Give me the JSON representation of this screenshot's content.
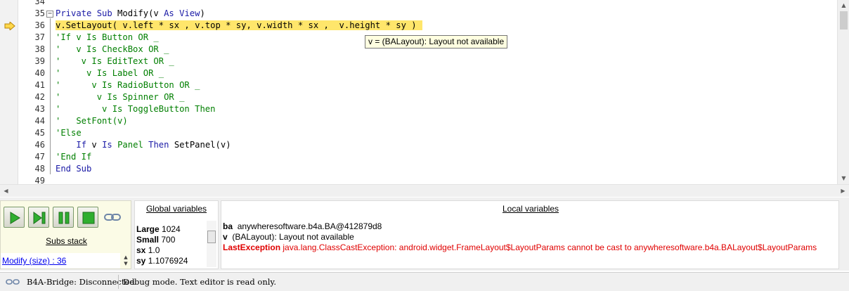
{
  "editor": {
    "lines": [
      {
        "num": "34",
        "segs": []
      },
      {
        "num": "35",
        "segs": [
          [
            "kw",
            "Private Sub"
          ],
          [
            "t",
            " Modify(v "
          ],
          [
            "kw",
            "As"
          ],
          [
            "t",
            " "
          ],
          [
            "kw",
            "View"
          ],
          [
            "t",
            ")"
          ]
        ]
      },
      {
        "num": "36",
        "segs": [
          [
            "t",
            "v.SetLayout( v.left * sx , v.top * sy, v.width * sx ,  v.height * sy )"
          ]
        ]
      },
      {
        "num": "37",
        "segs": [
          [
            "cm",
            "'If v Is Button OR _"
          ]
        ]
      },
      {
        "num": "38",
        "segs": [
          [
            "cm",
            "'   v Is CheckBox OR _"
          ]
        ]
      },
      {
        "num": "39",
        "segs": [
          [
            "cm",
            "'    v Is EditText OR _"
          ]
        ]
      },
      {
        "num": "40",
        "segs": [
          [
            "cm",
            "'     v Is Label OR _"
          ]
        ]
      },
      {
        "num": "41",
        "segs": [
          [
            "cm",
            "'      v Is RadioButton OR _"
          ]
        ]
      },
      {
        "num": "42",
        "segs": [
          [
            "cm",
            "'       v Is Spinner OR _"
          ]
        ]
      },
      {
        "num": "43",
        "segs": [
          [
            "cm",
            "'        v Is ToggleButton Then"
          ]
        ]
      },
      {
        "num": "44",
        "segs": [
          [
            "cm",
            "'   SetFont(v)"
          ]
        ]
      },
      {
        "num": "45",
        "segs": [
          [
            "cm",
            "'Else"
          ]
        ]
      },
      {
        "num": "46",
        "segs": [
          [
            "t",
            "    "
          ],
          [
            "kw",
            "If"
          ],
          [
            "t",
            " v "
          ],
          [
            "kw",
            "Is"
          ],
          [
            "t",
            " "
          ],
          [
            "cm",
            "Panel"
          ],
          [
            "t",
            " "
          ],
          [
            "kw",
            "Then"
          ],
          [
            "t",
            " SetPanel(v)"
          ]
        ]
      },
      {
        "num": "47",
        "segs": [
          [
            "cm",
            "'End If"
          ]
        ]
      },
      {
        "num": "48",
        "segs": [
          [
            "kw",
            "End Sub"
          ]
        ]
      },
      {
        "num": "49",
        "segs": []
      }
    ],
    "highlighted_line": "36",
    "tooltip": "v = (BALayout): Layout not available"
  },
  "subs_stack": {
    "title": "Subs stack",
    "items": [
      "Modify (size) : 36"
    ]
  },
  "global_variables": {
    "title": "Global variables",
    "items": [
      {
        "name": "Large",
        "value": "1024"
      },
      {
        "name": "Small",
        "value": "700"
      },
      {
        "name": "sx",
        "value": "1.0"
      },
      {
        "name": "sy",
        "value": "1.1076924"
      }
    ]
  },
  "local_variables": {
    "title": "Local variables",
    "items": [
      {
        "name": "ba",
        "value": "anywheresoftware.b4a.BA@412879d8",
        "error": false
      },
      {
        "name": "v",
        "value": "(BALayout): Layout not available",
        "error": false
      },
      {
        "name": "LastException",
        "value": "java.lang.ClassCastException: android.widget.FrameLayout$LayoutParams cannot be cast to anywheresoftware.b4a.BALayout$LayoutParams",
        "error": true
      }
    ]
  },
  "status_bar": {
    "bridge": "B4A-Bridge: Disconnected",
    "mode": "Debug mode. Text editor is read only."
  },
  "colors": {
    "keyword": "#1a1aa6",
    "comment": "#007f00",
    "highlight": "#ffe66b",
    "error": "#e00000",
    "debug_button_green": "#2fae2f"
  },
  "icons": {
    "current_line": "debug-arrow-icon",
    "toolbar": [
      "play-icon",
      "step-icon",
      "pause-icon",
      "stop-icon",
      "link-icon"
    ],
    "status": "bridge-icon"
  }
}
